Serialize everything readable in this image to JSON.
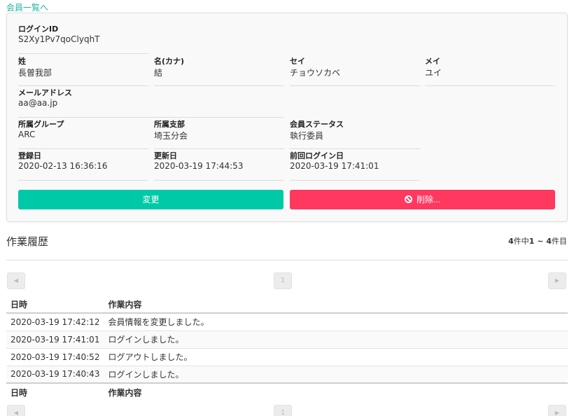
{
  "back_link": "会員一覧へ",
  "member": {
    "login_id": {
      "label": "ログインID",
      "value": "S2Xy1Pv7qoClyqhT"
    },
    "sei": {
      "label": "姓",
      "value": "長曽我部"
    },
    "mei": {
      "label": "名(カナ)",
      "value": "結"
    },
    "sei_kana": {
      "label": "セイ",
      "value": "チョウソカベ"
    },
    "mei_kana": {
      "label": "メイ",
      "value": "ユイ"
    },
    "email": {
      "label": "メールアドレス",
      "value": "aa@aa.jp"
    },
    "group": {
      "label": "所属グループ",
      "value": "ARC"
    },
    "branch": {
      "label": "所属支部",
      "value": "埼玉分会"
    },
    "status": {
      "label": "会員ステータス",
      "value": "執行委員"
    },
    "created": {
      "label": "登録日",
      "value": "2020-02-13 16:36:16"
    },
    "updated": {
      "label": "更新日",
      "value": "2020-03-19 17:44:53"
    },
    "last_login": {
      "label": "前回ログイン日",
      "value": "2020-03-19 17:41:01"
    }
  },
  "actions": {
    "edit": "変更",
    "delete": "削除..."
  },
  "history": {
    "title": "作業履歴",
    "count": {
      "total": "4",
      "mid": "件中",
      "from": "1",
      "sep": " ~ ",
      "to": "4",
      "suffix": "件目"
    },
    "page": "1",
    "columns": {
      "date": "日時",
      "content": "作業内容"
    },
    "rows": [
      {
        "date": "2020-03-19 17:42:12",
        "content": "会員情報を変更しました。"
      },
      {
        "date": "2020-03-19 17:41:01",
        "content": "ログインしました。"
      },
      {
        "date": "2020-03-19 17:40:52",
        "content": "ログアウトしました。"
      },
      {
        "date": "2020-03-19 17:40:43",
        "content": "ログインしました。"
      }
    ]
  },
  "colors": {
    "accent": "#00c9a7",
    "danger": "#ff3860",
    "link": "#1fb3a0"
  }
}
